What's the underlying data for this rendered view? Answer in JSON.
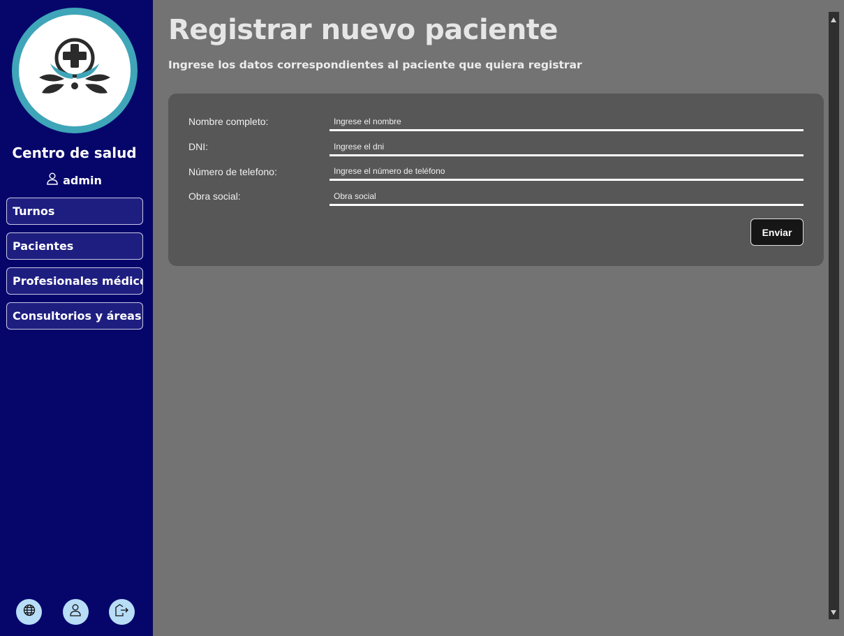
{
  "sidebar": {
    "brand_title": "Centro de salud",
    "user_name": "admin",
    "items": [
      {
        "label": "Turnos"
      },
      {
        "label": "Pacientes"
      },
      {
        "label": "Profesionales médicos"
      },
      {
        "label": "Consultorios y áreas"
      }
    ],
    "bottom_icons": [
      "globe-icon",
      "user-icon",
      "logout-icon"
    ]
  },
  "main": {
    "title": "Registrar nuevo paciente",
    "subtitle": "Ingrese los datos correspondientes al paciente que quiera registrar",
    "form": {
      "fields": [
        {
          "label": "Nombre completo:",
          "placeholder": "Ingrese el nombre"
        },
        {
          "label": "DNI:",
          "placeholder": "Ingrese el dni"
        },
        {
          "label": "Número de telefono:",
          "placeholder": "Ingrese el número de teléfono"
        },
        {
          "label": "Obra social:",
          "placeholder": "Obra social"
        }
      ],
      "submit_label": "Enviar"
    }
  },
  "colors": {
    "sidebar_bg": "#06066a",
    "main_bg": "#737373",
    "card_bg": "#575757",
    "logo_ring": "#3fa5b8",
    "icon_button_bg": "#b8ddf7"
  }
}
